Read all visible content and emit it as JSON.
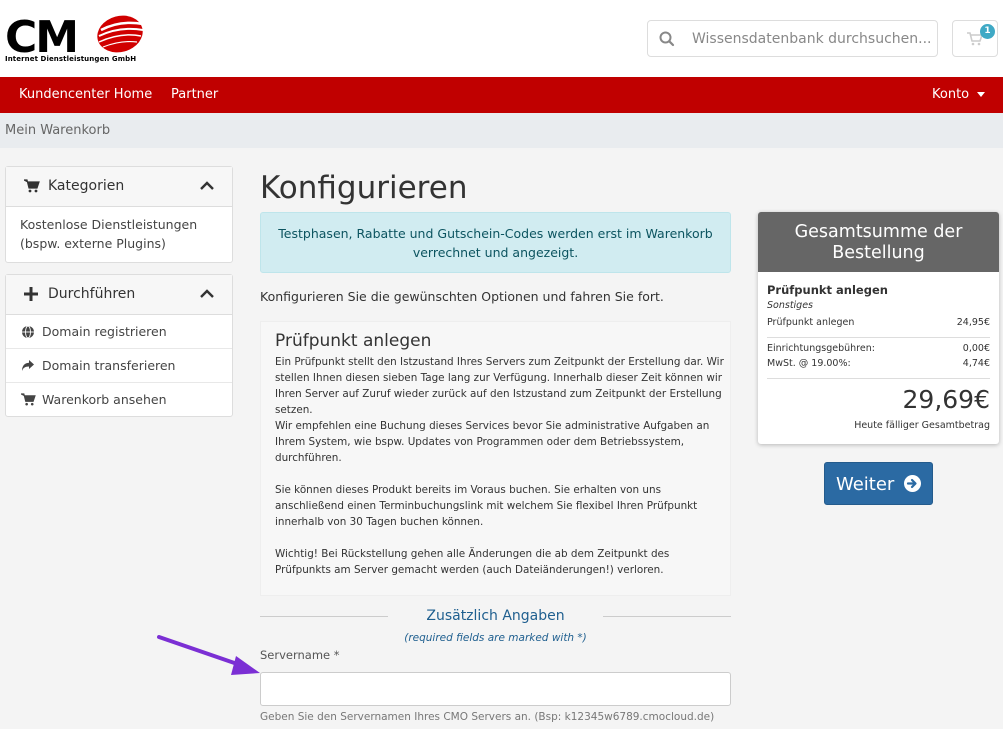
{
  "header": {
    "logo_text": "CMO",
    "logo_tagline": "Internet Dienstleistungen GmbH",
    "search_placeholder": "Wissensdatenbank durchsuchen...",
    "cart_count": "1"
  },
  "nav": {
    "home": "Kundencenter Home",
    "partner": "Partner",
    "konto": "Konto"
  },
  "breadcrumb": "Mein Warenkorb",
  "sidebar": {
    "categories": {
      "title": "Kategorien",
      "item": "Kostenlose Dienstleistungen (bspw. externe Plugins)"
    },
    "actions": {
      "title": "Durchführen",
      "items": [
        {
          "label": "Domain registrieren",
          "icon": "globe-icon"
        },
        {
          "label": "Domain transferieren",
          "icon": "share-arrow-icon"
        },
        {
          "label": "Warenkorb ansehen",
          "icon": "cart-icon"
        }
      ]
    }
  },
  "main": {
    "title": "Konfigurieren",
    "alert": "Testphasen, Rabatte und Gutschein-Codes werden erst im Warenkorb verrechnet und angezeigt.",
    "intro": "Konfigurieren Sie die gewünschten Optionen und fahren Sie fort.",
    "product": {
      "title": "Prüfpunkt anlegen",
      "p1": "Ein Prüfpunkt stellt den Istzustand Ihres Servers zum Zeitpunkt der Erstellung dar. Wir stellen Ihnen diesen sieben Tage lang zur Verfügung. Innerhalb dieser Zeit können wir Ihren Server auf Zuruf wieder zurück auf den Istzustand zum Zeitpunkt der Erstellung setzen.",
      "p1b": "Wir empfehlen eine Buchung dieses Services bevor Sie administrative Aufgaben an Ihrem System, wie bspw. Updates von Programmen oder dem Betriebssystem, durchführen.",
      "p2": "Sie können dieses Produkt bereits im Voraus buchen. Sie erhalten von uns anschließend einen Terminbuchungslink mit welchem Sie flexibel Ihren Prüfpunkt innerhalb von 30 Tagen buchen können.",
      "p3": "Wichtig! Bei Rückstellung gehen alle Änderungen die ab dem Zeitpunkt des Prüfpunkts am Server gemacht werden (auch Dateiänderungen!) verloren."
    },
    "section_title": "Zusätzlich Angaben",
    "required_note": "(required fields are marked with *)",
    "field_label": "Servername *",
    "field_value": "",
    "field_help": "Geben Sie den Servernamen Ihres CMO Servers an. (Bsp: k12345w6789.cmocloud.de)"
  },
  "summary": {
    "title": "Gesamtsumme der Bestellung",
    "product": "Prüfpunkt anlegen",
    "category": "Sonstiges",
    "line_label": "Prüfpunkt anlegen",
    "line_value": "24,95€",
    "setup_label": "Einrichtungsgebühren:",
    "setup_value": "0,00€",
    "tax_label": "MwSt. @ 19.00%:",
    "tax_value": "4,74€",
    "total": "29,69€",
    "total_label": "Heute fälliger Gesamtbetrag"
  },
  "weiter_label": "Weiter",
  "colors": {
    "brand_red": "#c00000",
    "button_blue": "#2b6aa3",
    "annotation_purple": "#7b2fd4"
  }
}
